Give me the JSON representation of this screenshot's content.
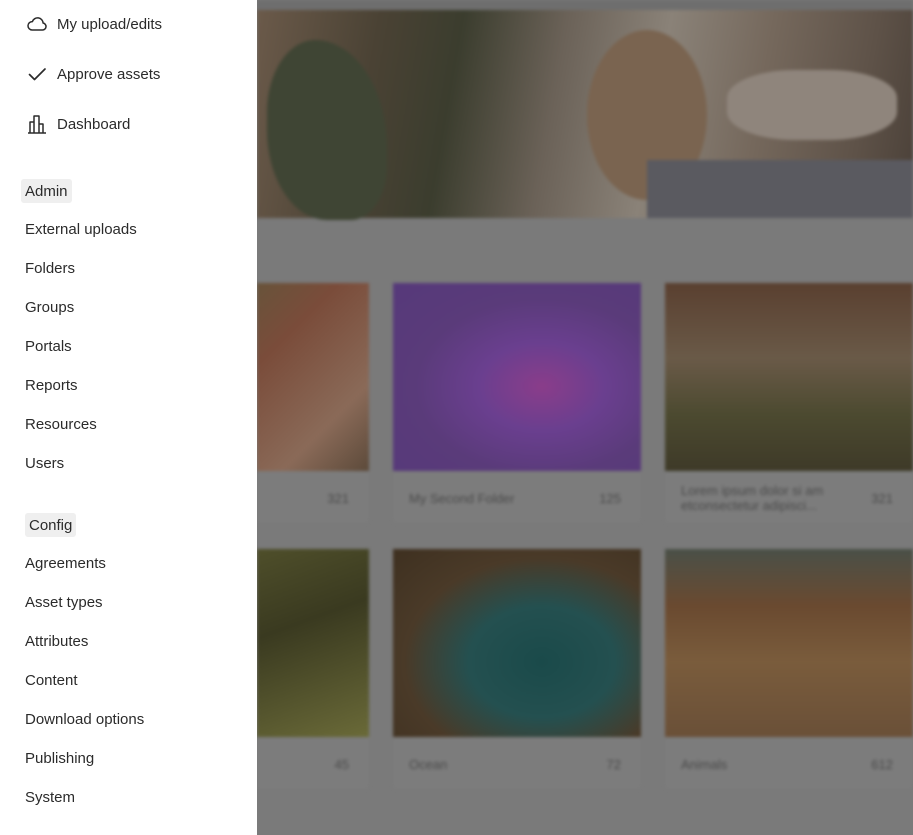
{
  "drawer": {
    "top_items": [
      {
        "label": "My upload/edits",
        "icon": "cloud-icon"
      },
      {
        "label": "Approve assets",
        "icon": "checkmark-icon"
      },
      {
        "label": "Dashboard",
        "icon": "bar-chart-icon"
      }
    ],
    "admin": {
      "label": "Admin",
      "items": [
        "External uploads",
        "Folders",
        "Groups",
        "Portals",
        "Reports",
        "Resources",
        "Users"
      ]
    },
    "config": {
      "label": "Config",
      "items": [
        "Agreements",
        "Asset types",
        "Attributes",
        "Content",
        "Download options",
        "Publishing",
        "System"
      ]
    }
  },
  "background": {
    "cards": [
      {
        "name": "",
        "count": "321"
      },
      {
        "name": "My Second Folder",
        "count": "125"
      },
      {
        "name": "Lorem ipsum dolor si am etconsectetur adipisci...",
        "count": "321"
      },
      {
        "name": "",
        "count": "45"
      },
      {
        "name": "Ocean",
        "count": "72"
      },
      {
        "name": "Animals",
        "count": "612"
      }
    ]
  },
  "colors": {
    "drawer_bg": "#ffffff",
    "overlay": "#7a7a7a",
    "text": "#2b2b2b",
    "section_label_bg": "#efefef"
  }
}
